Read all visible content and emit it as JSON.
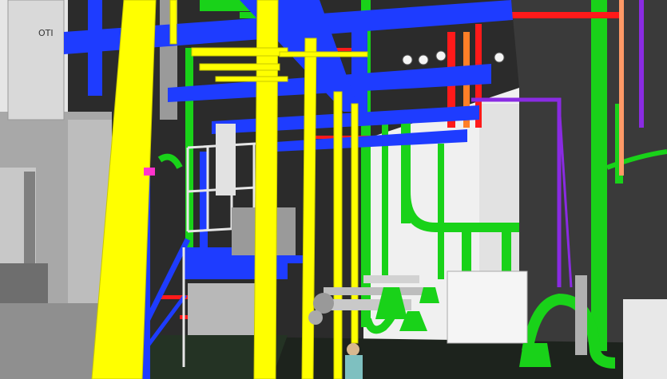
{
  "scene": {
    "equipment_label": "OTI"
  },
  "colors": {
    "background": "#2b2b2b",
    "wall_white": "#f1f1f1",
    "machine_grey": "#9c9c9c",
    "beam_blue": "#1e3cff",
    "column_yellow": "#ffff00",
    "pipe_green": "#19d219",
    "pipe_red": "#ff1a1a",
    "pipe_purple": "#8a2be2",
    "pipe_orange": "#ff7f27",
    "floor_dark": "#1d231d"
  },
  "icons": [
    "person-figure",
    "valve-handwheel"
  ]
}
